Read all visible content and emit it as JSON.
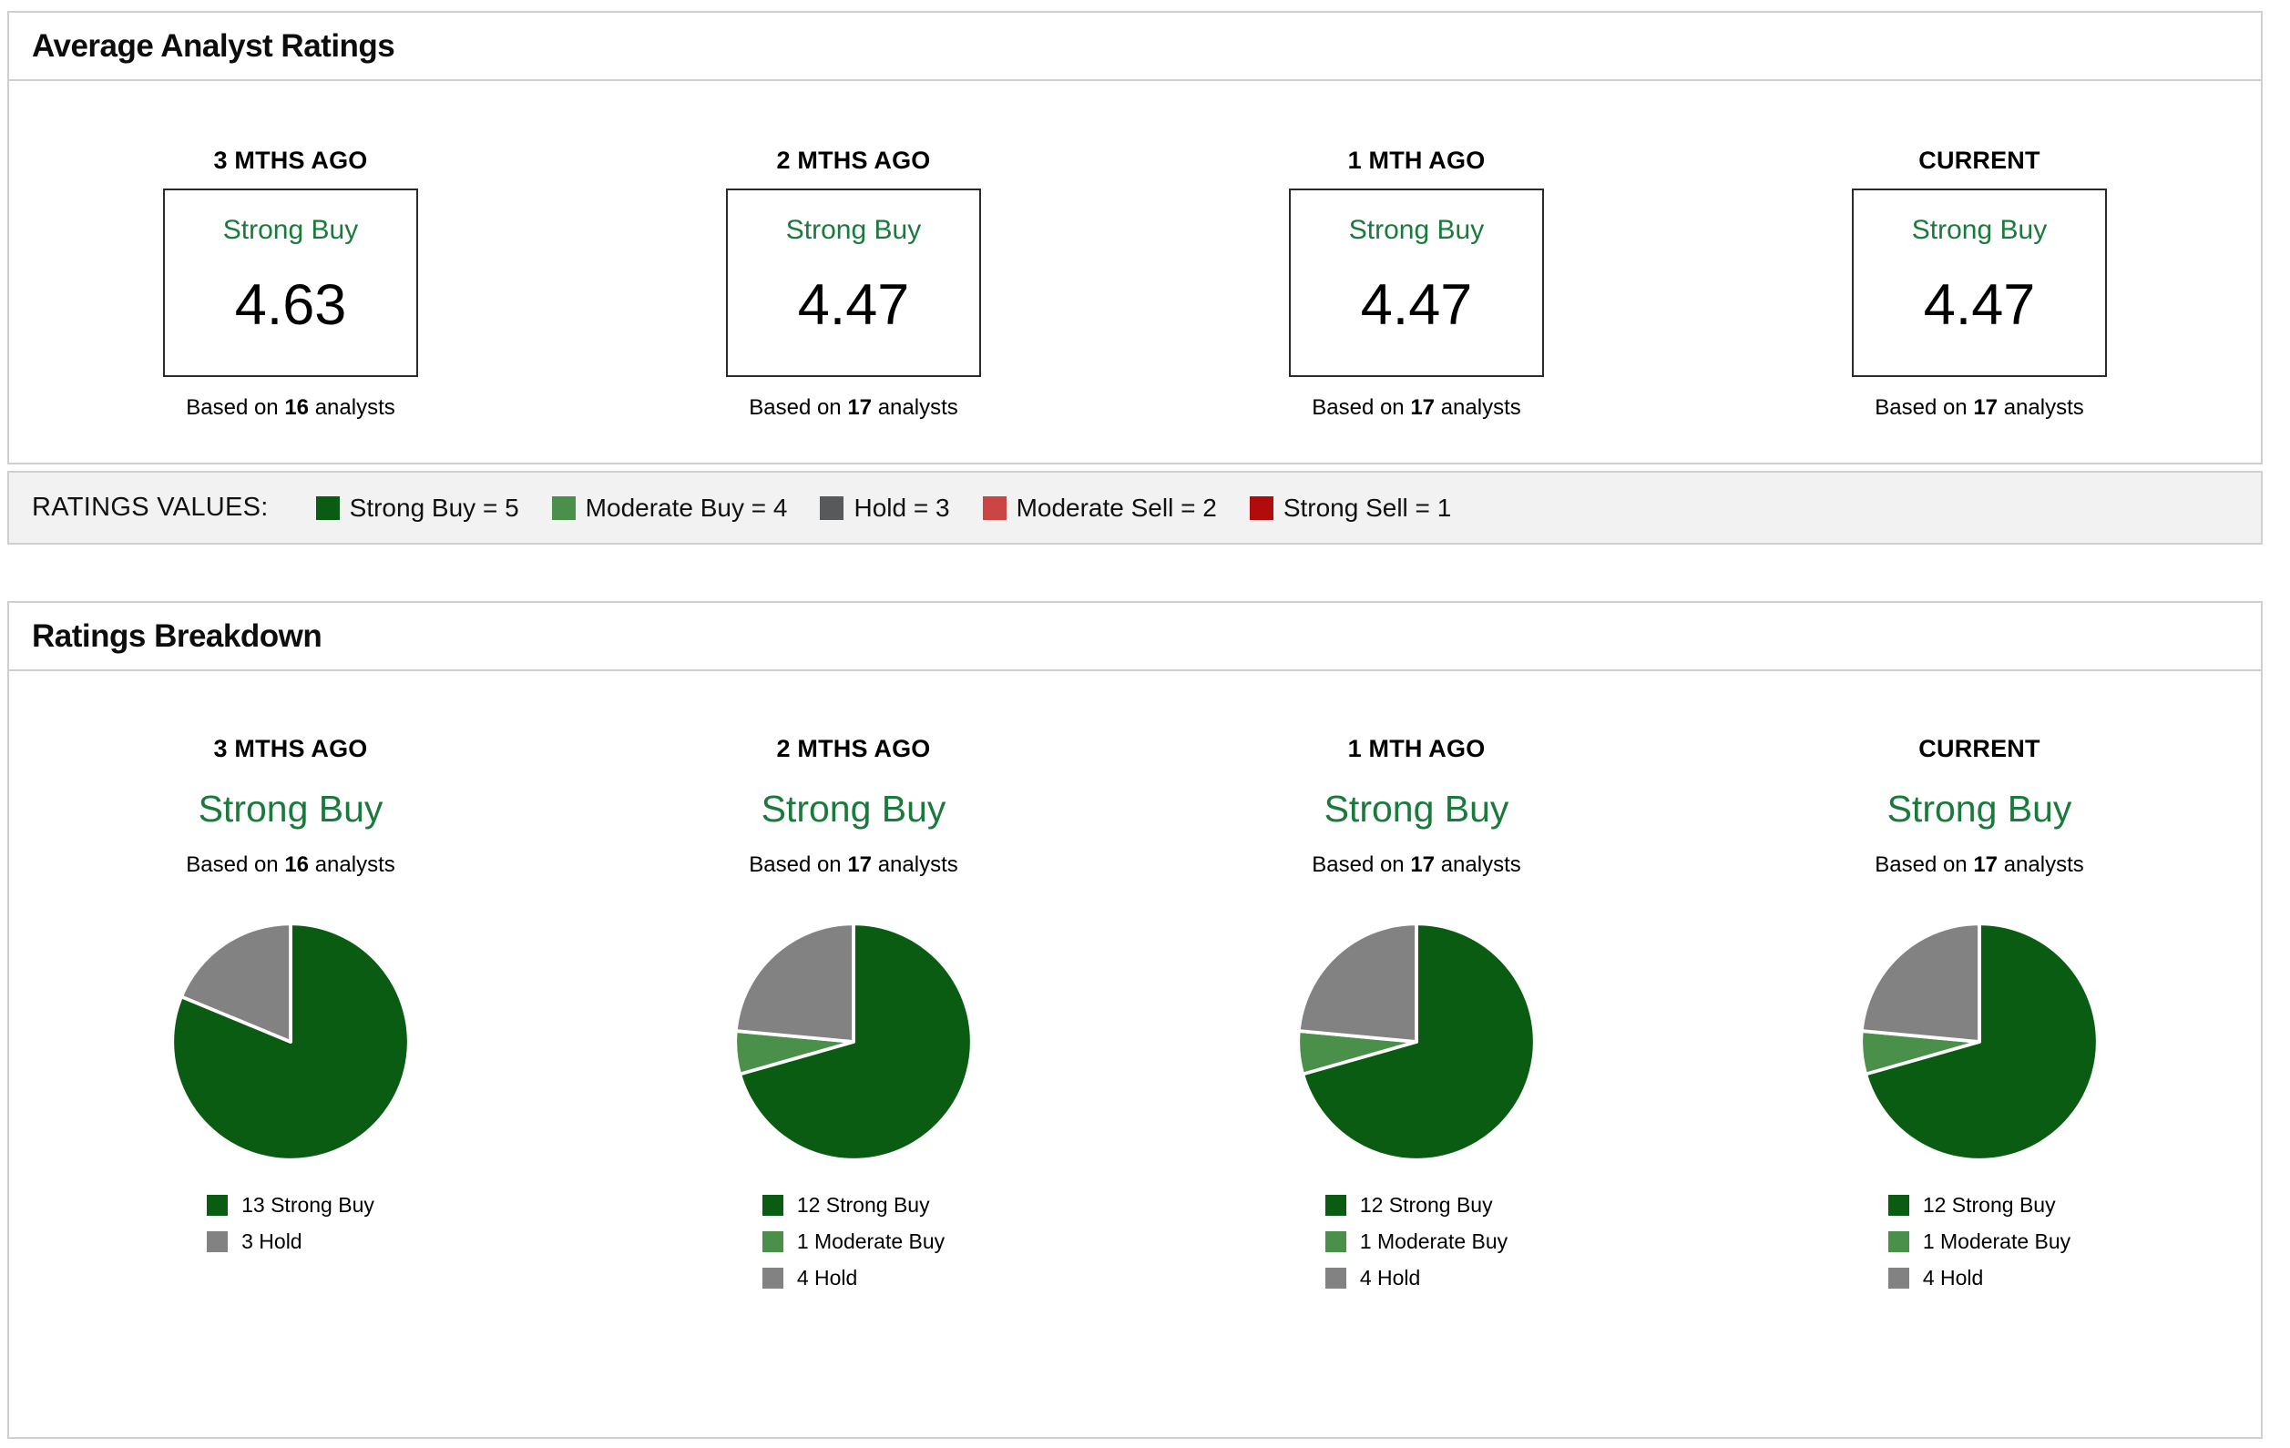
{
  "colors": {
    "strong_buy": "#095c11",
    "moderate_buy": "#4a8f4a",
    "hold_pie": "#828282",
    "hold_key": "#58595b",
    "moderate_sell": "#cc4545",
    "strong_sell": "#b20b0b",
    "rating_text_green": "#1a7a3c"
  },
  "average_ratings": {
    "title": "Average Analyst Ratings",
    "columns": [
      {
        "period": "3 MTHS AGO",
        "rating_label": "Strong Buy",
        "value": "4.63",
        "based_on": {
          "prefix": "Based on",
          "count": "16",
          "suffix": "analysts"
        }
      },
      {
        "period": "2 MTHS AGO",
        "rating_label": "Strong Buy",
        "value": "4.47",
        "based_on": {
          "prefix": "Based on",
          "count": "17",
          "suffix": "analysts"
        }
      },
      {
        "period": "1 MTH AGO",
        "rating_label": "Strong Buy",
        "value": "4.47",
        "based_on": {
          "prefix": "Based on",
          "count": "17",
          "suffix": "analysts"
        }
      },
      {
        "period": "CURRENT",
        "rating_label": "Strong Buy",
        "value": "4.47",
        "based_on": {
          "prefix": "Based on",
          "count": "17",
          "suffix": "analysts"
        }
      }
    ]
  },
  "ratings_values": {
    "label": "RATINGS VALUES:",
    "items": [
      {
        "label": "Strong Buy = 5",
        "color": "#095c11"
      },
      {
        "label": "Moderate Buy = 4",
        "color": "#4a8f4a"
      },
      {
        "label": "Hold = 3",
        "color": "#58595b"
      },
      {
        "label": "Moderate Sell = 2",
        "color": "#cc4545"
      },
      {
        "label": "Strong Sell = 1",
        "color": "#b20b0b"
      }
    ]
  },
  "ratings_breakdown": {
    "title": "Ratings Breakdown",
    "columns": [
      {
        "period": "3 MTHS AGO",
        "rating_label": "Strong Buy",
        "based_on": {
          "prefix": "Based on",
          "count": "16",
          "suffix": "analysts"
        },
        "slices": [
          {
            "label": "13 Strong Buy",
            "value": 13,
            "color": "#095c11"
          },
          {
            "label": "3 Hold",
            "value": 3,
            "color": "#828282"
          }
        ]
      },
      {
        "period": "2 MTHS AGO",
        "rating_label": "Strong Buy",
        "based_on": {
          "prefix": "Based on",
          "count": "17",
          "suffix": "analysts"
        },
        "slices": [
          {
            "label": "12 Strong Buy",
            "value": 12,
            "color": "#095c11"
          },
          {
            "label": "1 Moderate Buy",
            "value": 1,
            "color": "#4a8f4a"
          },
          {
            "label": "4 Hold",
            "value": 4,
            "color": "#828282"
          }
        ]
      },
      {
        "period": "1 MTH AGO",
        "rating_label": "Strong Buy",
        "based_on": {
          "prefix": "Based on",
          "count": "17",
          "suffix": "analysts"
        },
        "slices": [
          {
            "label": "12 Strong Buy",
            "value": 12,
            "color": "#095c11"
          },
          {
            "label": "1 Moderate Buy",
            "value": 1,
            "color": "#4a8f4a"
          },
          {
            "label": "4 Hold",
            "value": 4,
            "color": "#828282"
          }
        ]
      },
      {
        "period": "CURRENT",
        "rating_label": "Strong Buy",
        "based_on": {
          "prefix": "Based on",
          "count": "17",
          "suffix": "analysts"
        },
        "slices": [
          {
            "label": "12 Strong Buy",
            "value": 12,
            "color": "#095c11"
          },
          {
            "label": "1 Moderate Buy",
            "value": 1,
            "color": "#4a8f4a"
          },
          {
            "label": "4 Hold",
            "value": 4,
            "color": "#828282"
          }
        ]
      }
    ]
  },
  "chart_data": [
    {
      "type": "table",
      "title": "Average Analyst Ratings",
      "categories": [
        "3 MTHS AGO",
        "2 MTHS AGO",
        "1 MTH AGO",
        "CURRENT"
      ],
      "ratings": [
        "Strong Buy",
        "Strong Buy",
        "Strong Buy",
        "Strong Buy"
      ],
      "values": [
        4.63,
        4.47,
        4.47,
        4.47
      ],
      "analysts": [
        16,
        17,
        17,
        17
      ],
      "scale_legend": {
        "Strong Buy": 5,
        "Moderate Buy": 4,
        "Hold": 3,
        "Moderate Sell": 2,
        "Strong Sell": 1
      }
    },
    {
      "type": "pie",
      "title": "3 MTHS AGO",
      "subtitle": "Strong Buy",
      "analysts": 16,
      "labels": [
        "Strong Buy",
        "Hold"
      ],
      "values": [
        13,
        3
      ],
      "colors": [
        "#095c11",
        "#828282"
      ],
      "legend_position": "bottom"
    },
    {
      "type": "pie",
      "title": "2 MTHS AGO",
      "subtitle": "Strong Buy",
      "analysts": 17,
      "labels": [
        "Strong Buy",
        "Moderate Buy",
        "Hold"
      ],
      "values": [
        12,
        1,
        4
      ],
      "colors": [
        "#095c11",
        "#4a8f4a",
        "#828282"
      ],
      "legend_position": "bottom"
    },
    {
      "type": "pie",
      "title": "1 MTH AGO",
      "subtitle": "Strong Buy",
      "analysts": 17,
      "labels": [
        "Strong Buy",
        "Moderate Buy",
        "Hold"
      ],
      "values": [
        12,
        1,
        4
      ],
      "colors": [
        "#095c11",
        "#4a8f4a",
        "#828282"
      ],
      "legend_position": "bottom"
    },
    {
      "type": "pie",
      "title": "CURRENT",
      "subtitle": "Strong Buy",
      "analysts": 17,
      "labels": [
        "Strong Buy",
        "Moderate Buy",
        "Hold"
      ],
      "values": [
        12,
        1,
        4
      ],
      "colors": [
        "#095c11",
        "#4a8f4a",
        "#828282"
      ],
      "legend_position": "bottom"
    }
  ]
}
